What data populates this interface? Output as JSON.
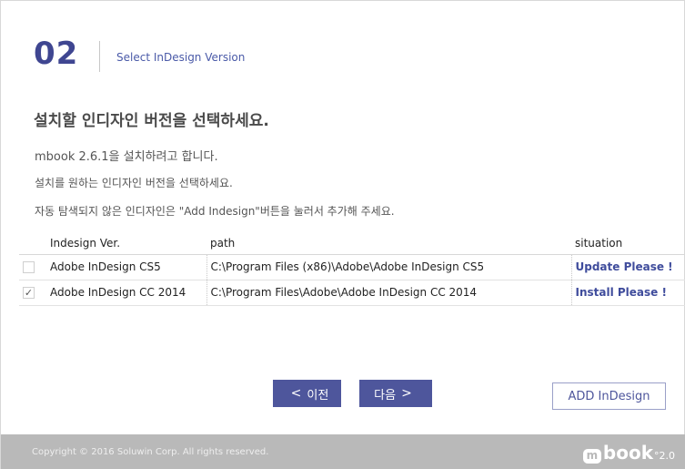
{
  "step": {
    "number": "02",
    "title": "Select InDesign Version"
  },
  "heading": "설치할 인디자인 버전을 선택하세요.",
  "descriptions": [
    "mbook 2.6.1을 설치하려고 합니다.",
    "설치를 원하는 인디자인 버전을 선택하세요.",
    "자동 탐색되지 않은 인디자인은 \"Add Indesign\"버튼을 눌러서 추가해 주세요."
  ],
  "table": {
    "headers": {
      "version": "Indesign Ver.",
      "path": "path",
      "situation": "situation"
    },
    "rows": [
      {
        "checked": false,
        "check_mark": "",
        "version": "Adobe InDesign CS5",
        "path": "C:\\Program Files (x86)\\Adobe\\Adobe InDesign CS5",
        "situation": "Update Please !"
      },
      {
        "checked": true,
        "check_mark": "✓",
        "version": "Adobe InDesign CC 2014",
        "path": "C:\\Program Files\\Adobe\\Adobe InDesign CC 2014",
        "situation": "Install Please !"
      }
    ]
  },
  "buttons": {
    "prev_arrow": "<",
    "prev_label": "이전",
    "next_label": "다음",
    "next_arrow": ">",
    "add_label": "ADD InDesign"
  },
  "footer": {
    "copyright": "Copyright © 2016 Soluwin Corp. All rights reserved.",
    "logo_m": "m",
    "logo_text": "book",
    "logo_version": "°2.0"
  },
  "colors": {
    "accent": "#4e569c",
    "footer_bg": "#b9b9b9"
  }
}
